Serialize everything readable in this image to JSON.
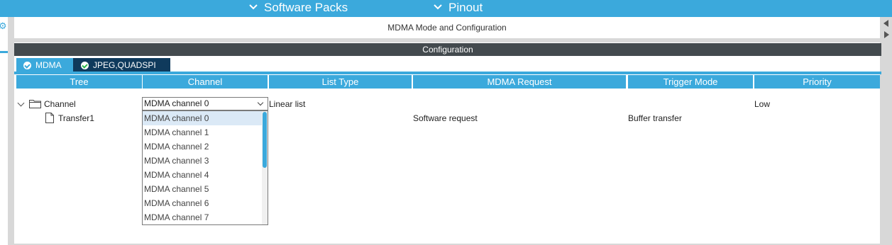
{
  "topnav": {
    "software_packs": "Software Packs",
    "pinout": "Pinout"
  },
  "mode_header": "MDMA Mode and Configuration",
  "config_bar": "Configuration",
  "tabs": [
    {
      "label": "MDMA",
      "active": true
    },
    {
      "label": "JPEG,QUADSPI",
      "active": false
    }
  ],
  "table": {
    "columns": [
      "Tree",
      "Channel",
      "List Type",
      "MDMA Request",
      "Trigger Mode",
      "Priority"
    ],
    "rows": [
      {
        "tree": "Channel",
        "channel": "MDMA channel 0",
        "list_type": "Linear list",
        "request": "",
        "trigger": "",
        "priority": "Low"
      },
      {
        "tree": "Transfer1",
        "channel": "",
        "list_type": "",
        "request": "Software request",
        "trigger": "Buffer transfer",
        "priority": ""
      }
    ]
  },
  "dropdown": {
    "selected": "MDMA channel 0",
    "options": [
      "MDMA channel 0",
      "MDMA channel 1",
      "MDMA channel 2",
      "MDMA channel 3",
      "MDMA channel 4",
      "MDMA channel 5",
      "MDMA channel 6",
      "MDMA channel 7"
    ]
  },
  "colors": {
    "accent": "#3ba9dc",
    "dark_tab": "#0f3a5c",
    "config_bar": "#434a4e",
    "selection": "#dbe9f6"
  }
}
